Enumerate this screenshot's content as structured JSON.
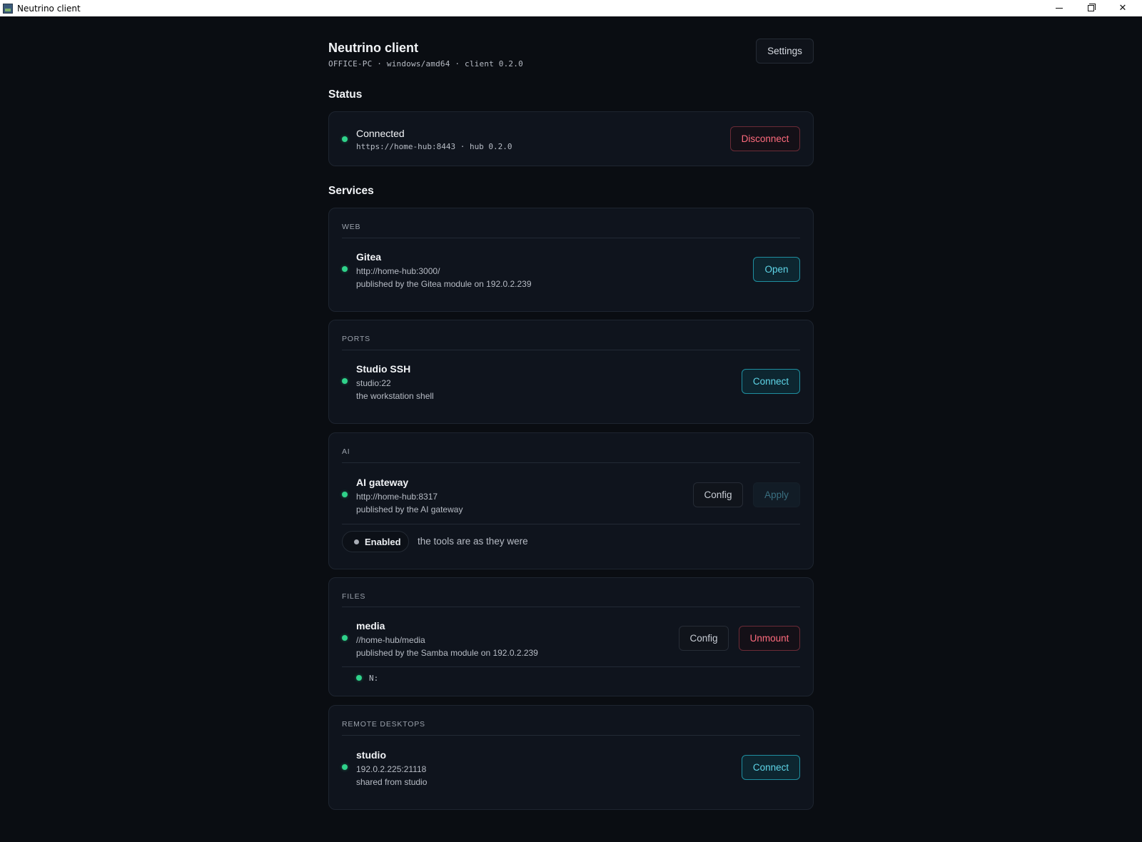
{
  "window": {
    "title": "Neutrino client"
  },
  "header": {
    "title": "Neutrino client",
    "subtitle": "OFFICE-PC · windows/amd64 · client 0.2.0",
    "settings_label": "Settings"
  },
  "status": {
    "heading": "Status",
    "state": "Connected",
    "detail": "https://home-hub:8443 · hub 0.2.0",
    "disconnect_label": "Disconnect",
    "indicator_color": "#2fd28a"
  },
  "services": {
    "heading": "Services",
    "web": {
      "category": "WEB",
      "name": "Gitea",
      "address": "http://home-hub:3000/",
      "description": "published by the Gitea module on 192.0.2.239",
      "action_label": "Open"
    },
    "ports": {
      "category": "PORTS",
      "name": "Studio SSH",
      "address": "studio:22",
      "description": "the workstation shell",
      "action_label": "Connect"
    },
    "ai": {
      "category": "AI",
      "name": "AI gateway",
      "address": "http://home-hub:8317",
      "description": "published by the AI gateway",
      "config_label": "Config",
      "apply_label": "Apply",
      "toggle_label": "Enabled",
      "toggle_note": "the tools are as they were"
    },
    "files": {
      "category": "FILES",
      "name": "media",
      "address": "//home-hub/media",
      "description": "published by the Samba module on 192.0.2.239",
      "config_label": "Config",
      "unmount_label": "Unmount",
      "drive": "N:"
    },
    "remote": {
      "category": "REMOTE DESKTOPS",
      "name": "studio",
      "address": "192.0.2.225:21118",
      "description": "shared from studio",
      "action_label": "Connect"
    }
  },
  "colors": {
    "background": "#0a0d12",
    "card": "#0f141d",
    "accent_teal": "#5fd6e8",
    "danger": "#ff6b7d",
    "online": "#2fd28a"
  }
}
